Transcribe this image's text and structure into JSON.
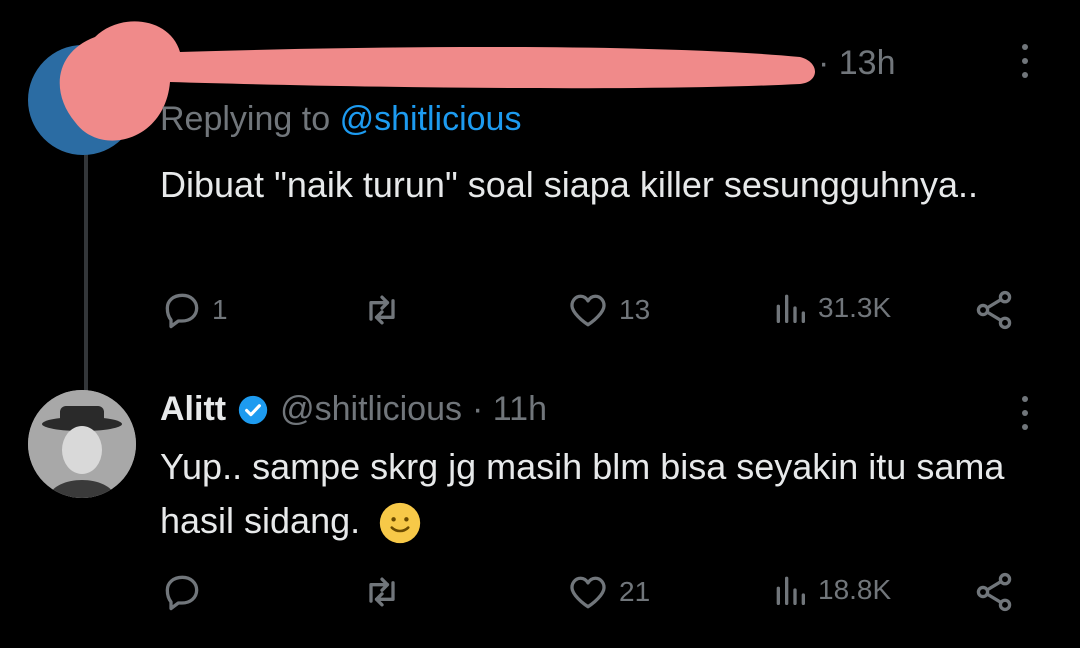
{
  "colors": {
    "background": "#000000",
    "text_primary": "#e7e9ea",
    "text_secondary": "#71767b",
    "accent": "#1d9bf0",
    "redaction": "#f08a8a",
    "thread_line": "#333639"
  },
  "tweet_1": {
    "time": "· 13h",
    "replying_prefix": "Replying to",
    "replying_handle": "@shitlicious",
    "text": "Dibuat \"naik turun\" soal siapa killer sesungguhnya..",
    "replies": "1",
    "retweets": "",
    "likes": "13",
    "views": "31.3K"
  },
  "tweet_2": {
    "display_name": "Alitt",
    "handle": "@shitlicious",
    "time": "· 11h",
    "text": "Yup.. sampe skrg jg masih blm bisa seyakin itu sama hasil sidang.",
    "emoji": "slightly-smiling-face",
    "replies": "",
    "retweets": "",
    "likes": "21",
    "views": "18.8K"
  },
  "icons": {
    "reply": "reply-icon",
    "retweet": "retweet-icon",
    "like": "heart-icon",
    "views": "views-icon",
    "share": "share-icon",
    "more": "more-icon",
    "verified": "verified-badge-icon"
  }
}
